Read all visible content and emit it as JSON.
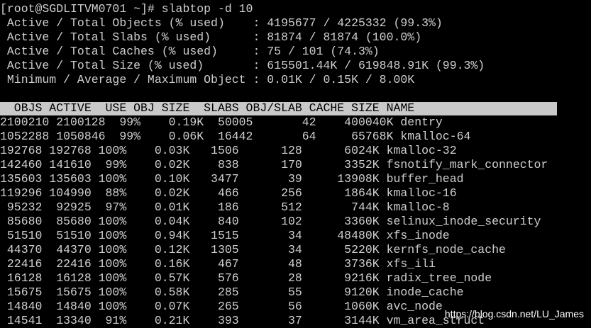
{
  "terminal": {
    "prompt": "[root@SGDLITVM0701 ~]# slabtop -d 10",
    "summary": [
      " Active / Total Objects (% used)    : 4195677 / 4225332 (99.3%)",
      " Active / Total Slabs (% used)      : 81874 / 81874 (100.0%)",
      " Active / Total Caches (% used)     : 75 / 101 (74.3%)",
      " Active / Total Size (% used)       : 615501.44K / 619848.91K (99.3%)",
      " Minimum / Average / Maximum Object : 0.01K / 0.15K / 8.00K"
    ],
    "table_header": "  OBJS ACTIVE  USE OBJ SIZE  SLABS OBJ/SLAB CACHE SIZE NAME",
    "rows": [
      "2100210 2100128  99%    0.19K  50005       42    400040K dentry",
      "1052288 1050846  99%    0.06K  16442       64     65768K kmalloc-64",
      "192768 192768 100%    0.03K   1506      128      6024K kmalloc-32",
      "142460 141610  99%    0.02K    838      170      3352K fsnotify_mark_connector",
      "135603 135603 100%    0.10K   3477       39     13908K buffer_head",
      "119296 104990  88%    0.02K    466      256      1864K kmalloc-16",
      " 95232  92925  97%    0.01K    186      512       744K kmalloc-8",
      " 85680  85680 100%    0.04K    840      102      3360K selinux_inode_security",
      " 51510  51510 100%    0.94K   1515       34     48480K xfs_inode",
      " 44370  44370 100%    0.12K   1305       34      5220K kernfs_node_cache",
      " 22416  22416 100%    0.16K    467       48      3736K xfs_ili",
      " 16128  16128 100%    0.57K    576       28      9216K radix_tree_node",
      " 15675  15675 100%    0.58K    285       55      9120K inode_cache",
      " 14840  14840 100%    0.07K    265       56      1060K avc_node",
      " 14541  13340  91%    0.21K    393       37      3144K vm_area_struct"
    ]
  },
  "watermark": "https://blog.csdn.net/LU_James",
  "colors": {
    "background": "#000000",
    "text": "#cfcfcf",
    "header_bar": "#c9c9c9",
    "header_text": "#000000"
  }
}
